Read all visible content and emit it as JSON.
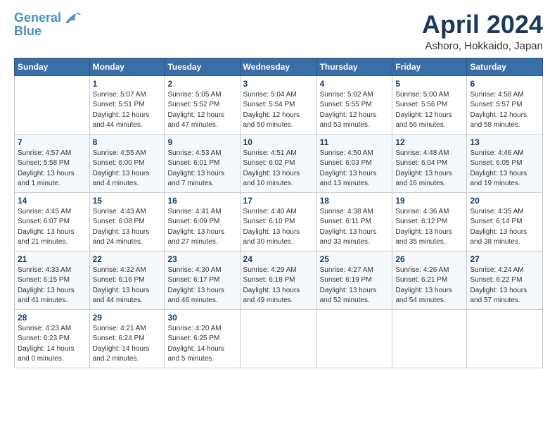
{
  "header": {
    "logo_line1": "General",
    "logo_line2": "Blue",
    "title": "April 2024",
    "subtitle": "Ashoro, Hokkaido, Japan"
  },
  "weekdays": [
    "Sunday",
    "Monday",
    "Tuesday",
    "Wednesday",
    "Thursday",
    "Friday",
    "Saturday"
  ],
  "weeks": [
    [
      {
        "day": "",
        "info": ""
      },
      {
        "day": "1",
        "info": "Sunrise: 5:07 AM\nSunset: 5:51 PM\nDaylight: 12 hours\nand 44 minutes."
      },
      {
        "day": "2",
        "info": "Sunrise: 5:05 AM\nSunset: 5:52 PM\nDaylight: 12 hours\nand 47 minutes."
      },
      {
        "day": "3",
        "info": "Sunrise: 5:04 AM\nSunset: 5:54 PM\nDaylight: 12 hours\nand 50 minutes."
      },
      {
        "day": "4",
        "info": "Sunrise: 5:02 AM\nSunset: 5:55 PM\nDaylight: 12 hours\nand 53 minutes."
      },
      {
        "day": "5",
        "info": "Sunrise: 5:00 AM\nSunset: 5:56 PM\nDaylight: 12 hours\nand 56 minutes."
      },
      {
        "day": "6",
        "info": "Sunrise: 4:58 AM\nSunset: 5:57 PM\nDaylight: 12 hours\nand 58 minutes."
      }
    ],
    [
      {
        "day": "7",
        "info": "Sunrise: 4:57 AM\nSunset: 5:58 PM\nDaylight: 13 hours\nand 1 minute."
      },
      {
        "day": "8",
        "info": "Sunrise: 4:55 AM\nSunset: 6:00 PM\nDaylight: 13 hours\nand 4 minutes."
      },
      {
        "day": "9",
        "info": "Sunrise: 4:53 AM\nSunset: 6:01 PM\nDaylight: 13 hours\nand 7 minutes."
      },
      {
        "day": "10",
        "info": "Sunrise: 4:51 AM\nSunset: 6:02 PM\nDaylight: 13 hours\nand 10 minutes."
      },
      {
        "day": "11",
        "info": "Sunrise: 4:50 AM\nSunset: 6:03 PM\nDaylight: 13 hours\nand 13 minutes."
      },
      {
        "day": "12",
        "info": "Sunrise: 4:48 AM\nSunset: 6:04 PM\nDaylight: 13 hours\nand 16 minutes."
      },
      {
        "day": "13",
        "info": "Sunrise: 4:46 AM\nSunset: 6:05 PM\nDaylight: 13 hours\nand 19 minutes."
      }
    ],
    [
      {
        "day": "14",
        "info": "Sunrise: 4:45 AM\nSunset: 6:07 PM\nDaylight: 13 hours\nand 21 minutes."
      },
      {
        "day": "15",
        "info": "Sunrise: 4:43 AM\nSunset: 6:08 PM\nDaylight: 13 hours\nand 24 minutes."
      },
      {
        "day": "16",
        "info": "Sunrise: 4:41 AM\nSunset: 6:09 PM\nDaylight: 13 hours\nand 27 minutes."
      },
      {
        "day": "17",
        "info": "Sunrise: 4:40 AM\nSunset: 6:10 PM\nDaylight: 13 hours\nand 30 minutes."
      },
      {
        "day": "18",
        "info": "Sunrise: 4:38 AM\nSunset: 6:11 PM\nDaylight: 13 hours\nand 33 minutes."
      },
      {
        "day": "19",
        "info": "Sunrise: 4:36 AM\nSunset: 6:12 PM\nDaylight: 13 hours\nand 35 minutes."
      },
      {
        "day": "20",
        "info": "Sunrise: 4:35 AM\nSunset: 6:14 PM\nDaylight: 13 hours\nand 38 minutes."
      }
    ],
    [
      {
        "day": "21",
        "info": "Sunrise: 4:33 AM\nSunset: 6:15 PM\nDaylight: 13 hours\nand 41 minutes."
      },
      {
        "day": "22",
        "info": "Sunrise: 4:32 AM\nSunset: 6:16 PM\nDaylight: 13 hours\nand 44 minutes."
      },
      {
        "day": "23",
        "info": "Sunrise: 4:30 AM\nSunset: 6:17 PM\nDaylight: 13 hours\nand 46 minutes."
      },
      {
        "day": "24",
        "info": "Sunrise: 4:29 AM\nSunset: 6:18 PM\nDaylight: 13 hours\nand 49 minutes."
      },
      {
        "day": "25",
        "info": "Sunrise: 4:27 AM\nSunset: 6:19 PM\nDaylight: 13 hours\nand 52 minutes."
      },
      {
        "day": "26",
        "info": "Sunrise: 4:26 AM\nSunset: 6:21 PM\nDaylight: 13 hours\nand 54 minutes."
      },
      {
        "day": "27",
        "info": "Sunrise: 4:24 AM\nSunset: 6:22 PM\nDaylight: 13 hours\nand 57 minutes."
      }
    ],
    [
      {
        "day": "28",
        "info": "Sunrise: 4:23 AM\nSunset: 6:23 PM\nDaylight: 14 hours\nand 0 minutes."
      },
      {
        "day": "29",
        "info": "Sunrise: 4:21 AM\nSunset: 6:24 PM\nDaylight: 14 hours\nand 2 minutes."
      },
      {
        "day": "30",
        "info": "Sunrise: 4:20 AM\nSunset: 6:25 PM\nDaylight: 14 hours\nand 5 minutes."
      },
      {
        "day": "",
        "info": ""
      },
      {
        "day": "",
        "info": ""
      },
      {
        "day": "",
        "info": ""
      },
      {
        "day": "",
        "info": ""
      }
    ]
  ]
}
